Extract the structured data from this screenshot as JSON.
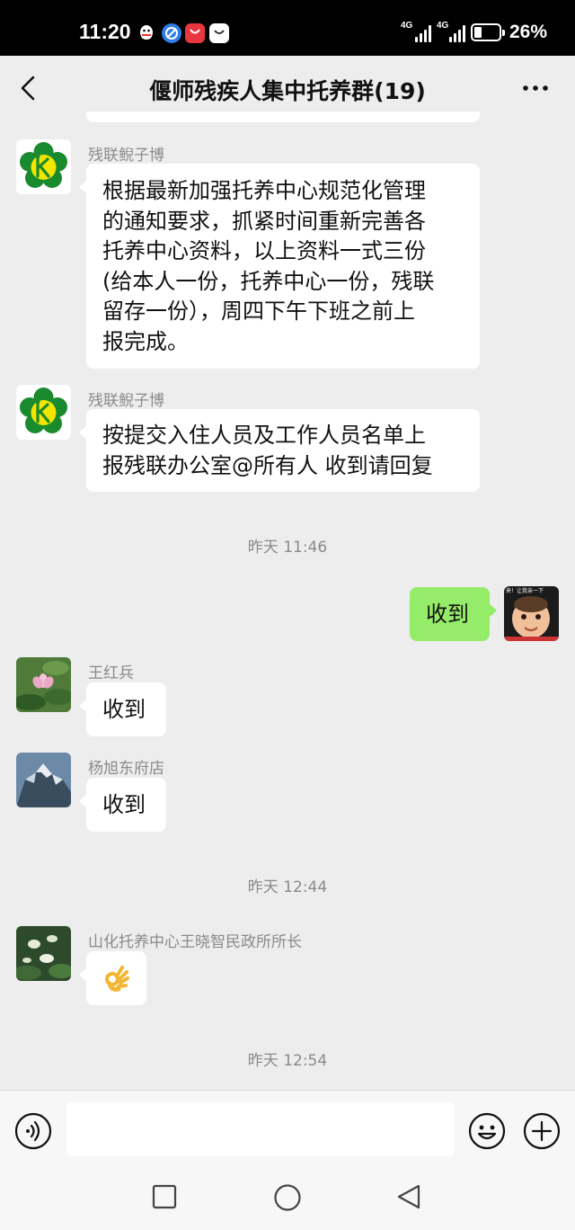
{
  "status_bar": {
    "time": "11:20",
    "network_1": "4G",
    "network_2": "4G",
    "battery": "26%",
    "notification_icons": [
      "qq-icon",
      "browser-icon",
      "huawei-store-icon",
      "huawei-icon"
    ]
  },
  "header": {
    "title": "偃师残疾人集中托养群(19)"
  },
  "messages": [
    {
      "sender": "残联鲵子博",
      "avatar": "disabled-federation-logo-icon",
      "lines": [
        "根据最新加强托养中心规范化管理",
        "的通知要求，抓紧时间重新完善各",
        "托养中心资料，以上资料一式三份",
        "(给本人一份，托养中心一份，残联",
        "留存一份），周四下午下班之前上",
        "报完成。"
      ]
    },
    {
      "sender": "残联鲵子博",
      "avatar": "disabled-federation-logo-icon",
      "lines": [
        "按提交入住人员及工作人员名单上",
        "报残联办公室@所有人  收到请回复"
      ]
    },
    {
      "timestamp": "昨天 11:46"
    },
    {
      "self": true,
      "text": "收到",
      "avatar": "baby-photo-avatar"
    },
    {
      "sender": "王红兵",
      "avatar": "lotus-avatar",
      "text": "收到"
    },
    {
      "sender": "杨旭东府店",
      "avatar": "mountain-avatar",
      "text": "收到"
    },
    {
      "timestamp": "昨天 12:44"
    },
    {
      "sender": "山化托养中心王晓智民政所所长",
      "avatar": "white-lotus-avatar",
      "emoji": "ok-hand-icon"
    },
    {
      "timestamp": "昨天 12:54"
    }
  ],
  "self_avatar_caption": "来！让我亲一下",
  "input_bar": {
    "placeholder": ""
  },
  "colors": {
    "background": "#ededed",
    "self_bubble": "#95ec69",
    "other_bubble": "#ffffff",
    "logo_green": "#1a8a2e",
    "logo_yellow": "#f2e600"
  }
}
